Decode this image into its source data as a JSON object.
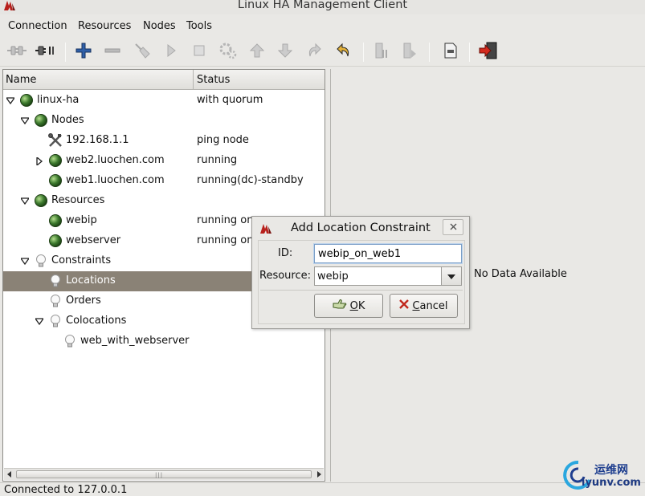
{
  "window": {
    "title": "Linux HA Management Client"
  },
  "menu": [
    "Connection",
    "Resources",
    "Nodes",
    "Tools"
  ],
  "tree": {
    "columns": {
      "name": "Name",
      "status": "Status"
    },
    "rows": [
      {
        "label": "linux-ha",
        "status": "with quorum",
        "icon": "green-status-icon",
        "expander": "expanded"
      },
      {
        "label": "Nodes",
        "status": "",
        "icon": "green-status-icon",
        "expander": "expanded"
      },
      {
        "label": "192.168.1.1",
        "status": "ping node",
        "icon": "tools-icon",
        "expander": "none"
      },
      {
        "label": "web2.luochen.com",
        "status": "running",
        "icon": "green-status-icon",
        "expander": "collapsed"
      },
      {
        "label": "web1.luochen.com",
        "status": "running(dc)-standby",
        "icon": "green-status-icon",
        "expander": "none"
      },
      {
        "label": "Resources",
        "status": "",
        "icon": "green-status-icon",
        "expander": "expanded"
      },
      {
        "label": "webip",
        "status": "running on",
        "icon": "green-status-icon",
        "expander": "none"
      },
      {
        "label": "webserver",
        "status": "running on",
        "icon": "green-status-icon",
        "expander": "none"
      },
      {
        "label": "Constraints",
        "status": "",
        "icon": "lightbulb-icon",
        "expander": "expanded"
      },
      {
        "label": "Locations",
        "status": "",
        "icon": "lightbulb-icon",
        "expander": "none",
        "selected": true
      },
      {
        "label": "Orders",
        "status": "",
        "icon": "lightbulb-icon",
        "expander": "none"
      },
      {
        "label": "Colocations",
        "status": "",
        "icon": "lightbulb-icon",
        "expander": "expanded"
      },
      {
        "label": "web_with_webserver",
        "status": "",
        "icon": "lightbulb-icon",
        "expander": "none"
      }
    ]
  },
  "detail": {
    "empty_text": "No Data Available"
  },
  "status_bar": {
    "text": "Connected to 127.0.0.1"
  },
  "dialog": {
    "title": "Add Location Constraint",
    "id_label": "ID:",
    "id_value": "webip_on_web1",
    "resource_label": "Resource:",
    "resource_value": "webip",
    "ok_mnemonic": "O",
    "ok_rest": "K",
    "cancel_mnemonic": "C",
    "cancel_rest": "ancel"
  },
  "watermark": {
    "cn": "运维网",
    "url": "iyunv.com"
  },
  "colors": {
    "selection": "#8a8276",
    "status_green": "#3d7a2e",
    "accent_blue": "#1f3f8f"
  }
}
